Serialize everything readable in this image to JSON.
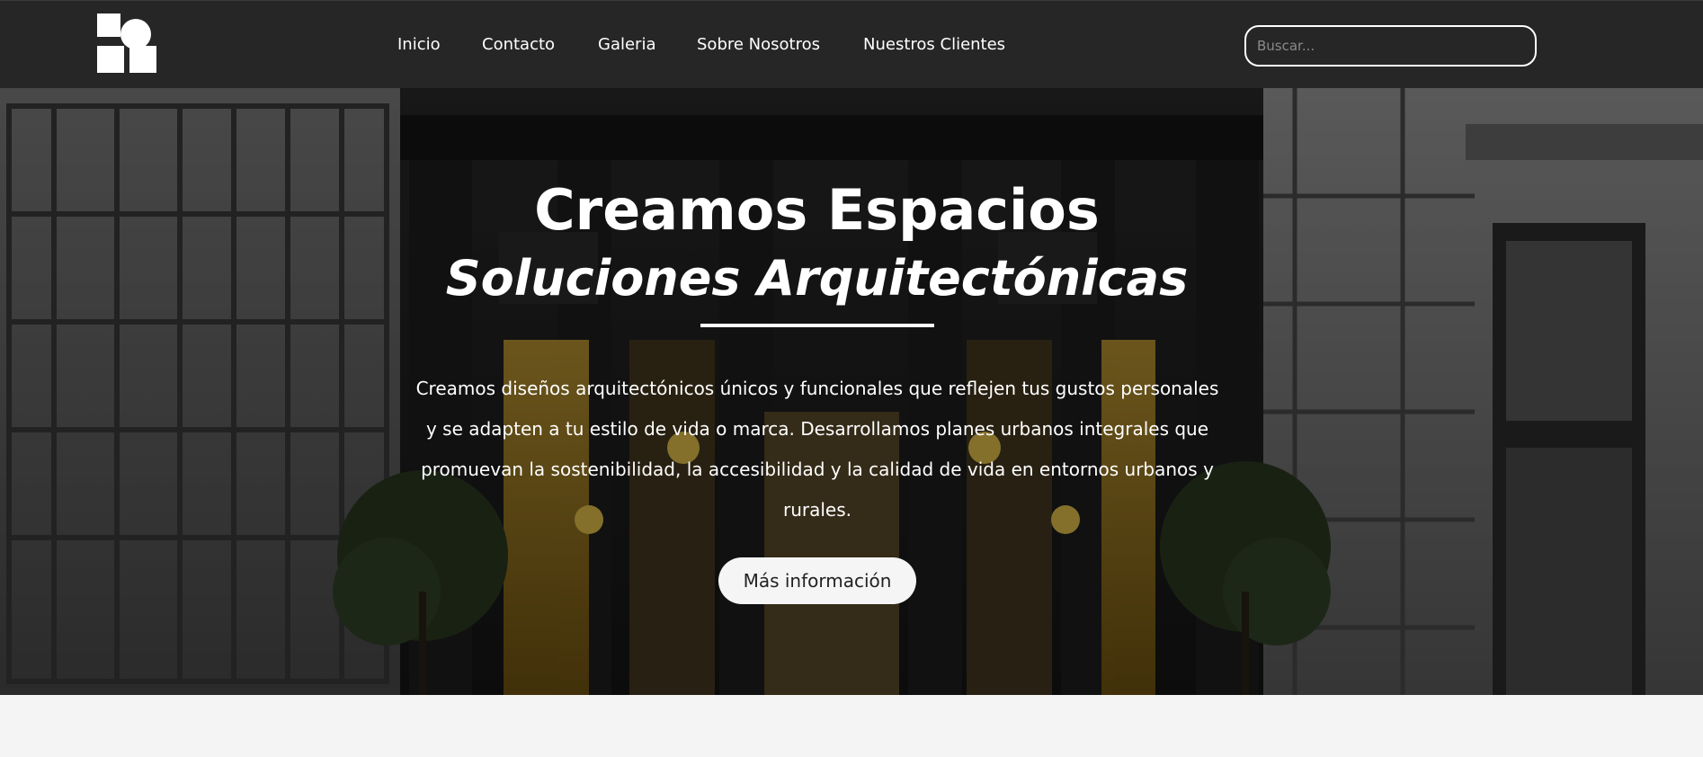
{
  "logo": {
    "icon": "geometric-logo-icon"
  },
  "nav": {
    "items": [
      {
        "label": "Inicio"
      },
      {
        "label": "Contacto"
      },
      {
        "label": "Galeria"
      },
      {
        "label": "Sobre Nosotros"
      },
      {
        "label": "Nuestros Clientes"
      }
    ]
  },
  "search": {
    "placeholder": "Buscar..."
  },
  "hero": {
    "title": "Creamos Espacios",
    "subtitle": "Soluciones Arquitectónicas",
    "description": "Creamos diseños arquitectónicos únicos y funcionales que reflejen tus gustos personales y se adapten a tu estilo de vida o marca. Desarrollamos planes urbanos integrales que promuevan la sostenibilidad, la accesibilidad y la calidad de vida en entornos urbanos y rurales.",
    "button_label": "Más información"
  },
  "colors": {
    "navbar": "#262626",
    "accent": "#ffffff",
    "page_bg": "#f4f4f4"
  }
}
